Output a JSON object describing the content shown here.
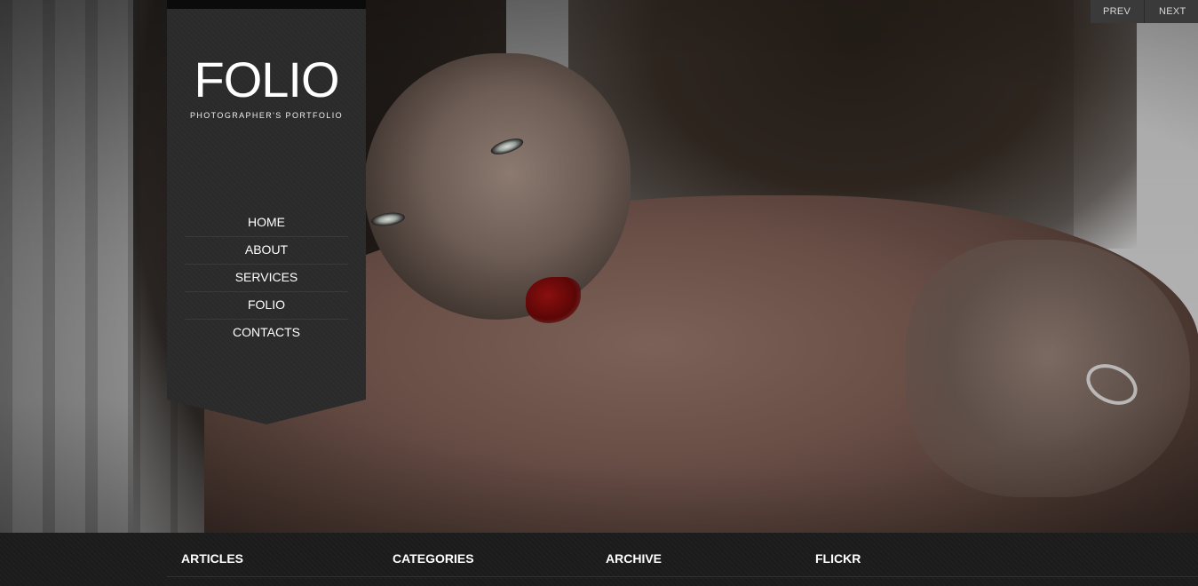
{
  "brand": {
    "logo": "FOLIO",
    "tagline": "PHOTOGRAPHER'S PORTFOLIO"
  },
  "nav": {
    "items": [
      {
        "label": "HOME"
      },
      {
        "label": "ABOUT"
      },
      {
        "label": "SERVICES"
      },
      {
        "label": "FOLIO"
      },
      {
        "label": "CONTACTS"
      }
    ]
  },
  "slider": {
    "prev_label": "PREV",
    "next_label": "NEXT"
  },
  "footer": {
    "columns": [
      {
        "title": "ARTICLES"
      },
      {
        "title": "CATEGORIES"
      },
      {
        "title": "ARCHIVE"
      },
      {
        "title": "FLICKR"
      }
    ]
  },
  "colors": {
    "panel": "#2a2a2a",
    "footer": "#1b1b1b",
    "text": "#ffffff",
    "blood": "#8a0f0f"
  }
}
